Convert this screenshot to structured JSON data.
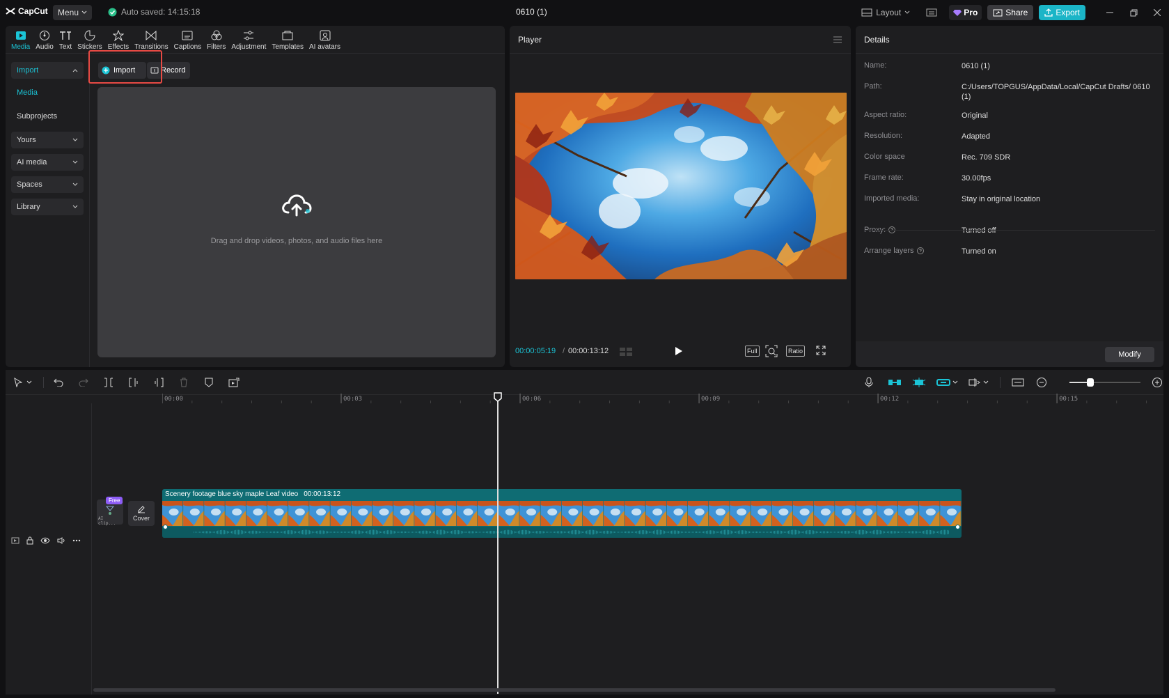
{
  "app": {
    "logo_text": "CapCut",
    "menu_label": "Menu",
    "autosave_text": "Auto saved: 14:15:18",
    "doc_title": "0610 (1)",
    "layout_label": "Layout",
    "pro_label": "Pro",
    "share_label": "Share",
    "export_label": "Export",
    "accent_color": "#1bc4d6"
  },
  "media_tabs": [
    {
      "label": "Media",
      "icon": "media-icon",
      "active": true
    },
    {
      "label": "Audio",
      "icon": "audio-icon"
    },
    {
      "label": "Text",
      "icon": "text-icon"
    },
    {
      "label": "Stickers",
      "icon": "stickers-icon"
    },
    {
      "label": "Effects",
      "icon": "effects-icon"
    },
    {
      "label": "Transitions",
      "icon": "transitions-icon"
    },
    {
      "label": "Captions",
      "icon": "captions-icon"
    },
    {
      "label": "Filters",
      "icon": "filters-icon"
    },
    {
      "label": "Adjustment",
      "icon": "adjustment-icon"
    },
    {
      "label": "Templates",
      "icon": "templates-icon"
    },
    {
      "label": "AI avatars",
      "icon": "ai-avatars-icon"
    }
  ],
  "sidebar": {
    "items": [
      {
        "label": "Import",
        "type": "box-selected",
        "caret": "up"
      },
      {
        "label": "Media",
        "type": "plain-selected"
      },
      {
        "label": "Subprojects",
        "type": "plain"
      },
      {
        "label": "Yours",
        "type": "box",
        "caret": "down"
      },
      {
        "label": "AI media",
        "type": "box",
        "caret": "down"
      },
      {
        "label": "Spaces",
        "type": "box",
        "caret": "down"
      },
      {
        "label": "Library",
        "type": "box",
        "caret": "down"
      }
    ]
  },
  "import_area": {
    "import_label": "Import",
    "record_label": "Record",
    "drop_text": "Drag and drop videos, photos, and audio files here"
  },
  "player": {
    "title": "Player",
    "current_time": "00:00:05:19",
    "separator": "/",
    "duration": "00:00:13:12",
    "full_label": "Full",
    "ratio_label": "Ratio"
  },
  "details": {
    "title": "Details",
    "rows": [
      {
        "key": "Name:",
        "value": "0610 (1)"
      },
      {
        "key": "Path:",
        "value": "C:/Users/TOPGUS/AppData/Local/CapCut Drafts/ 0610 (1)"
      },
      {
        "key": "Aspect ratio:",
        "value": "Original"
      },
      {
        "key": "Resolution:",
        "value": "Adapted"
      },
      {
        "key": "Color space",
        "value": "Rec. 709 SDR"
      },
      {
        "key": "Frame rate:",
        "value": "30.00fps"
      },
      {
        "key": "Imported media:",
        "value": "Stay in original location"
      },
      {
        "key": "Proxy:",
        "value": "Turned off"
      },
      {
        "key": "Arrange layers",
        "value": "Turned on"
      }
    ],
    "modify_label": "Modify"
  },
  "timeline": {
    "ruler_labels": [
      "00:00",
      "00:03",
      "00:06",
      "00:09",
      "00:12",
      "00:15"
    ],
    "free_badge": "Free",
    "thumb_caption": "AI clip...",
    "cover_label": "Cover",
    "clip_title": "Scenery footage blue sky maple Leaf video",
    "clip_duration": "00:00:13:12",
    "playhead_time_sec": 5.63,
    "total_sec": 13.4
  }
}
